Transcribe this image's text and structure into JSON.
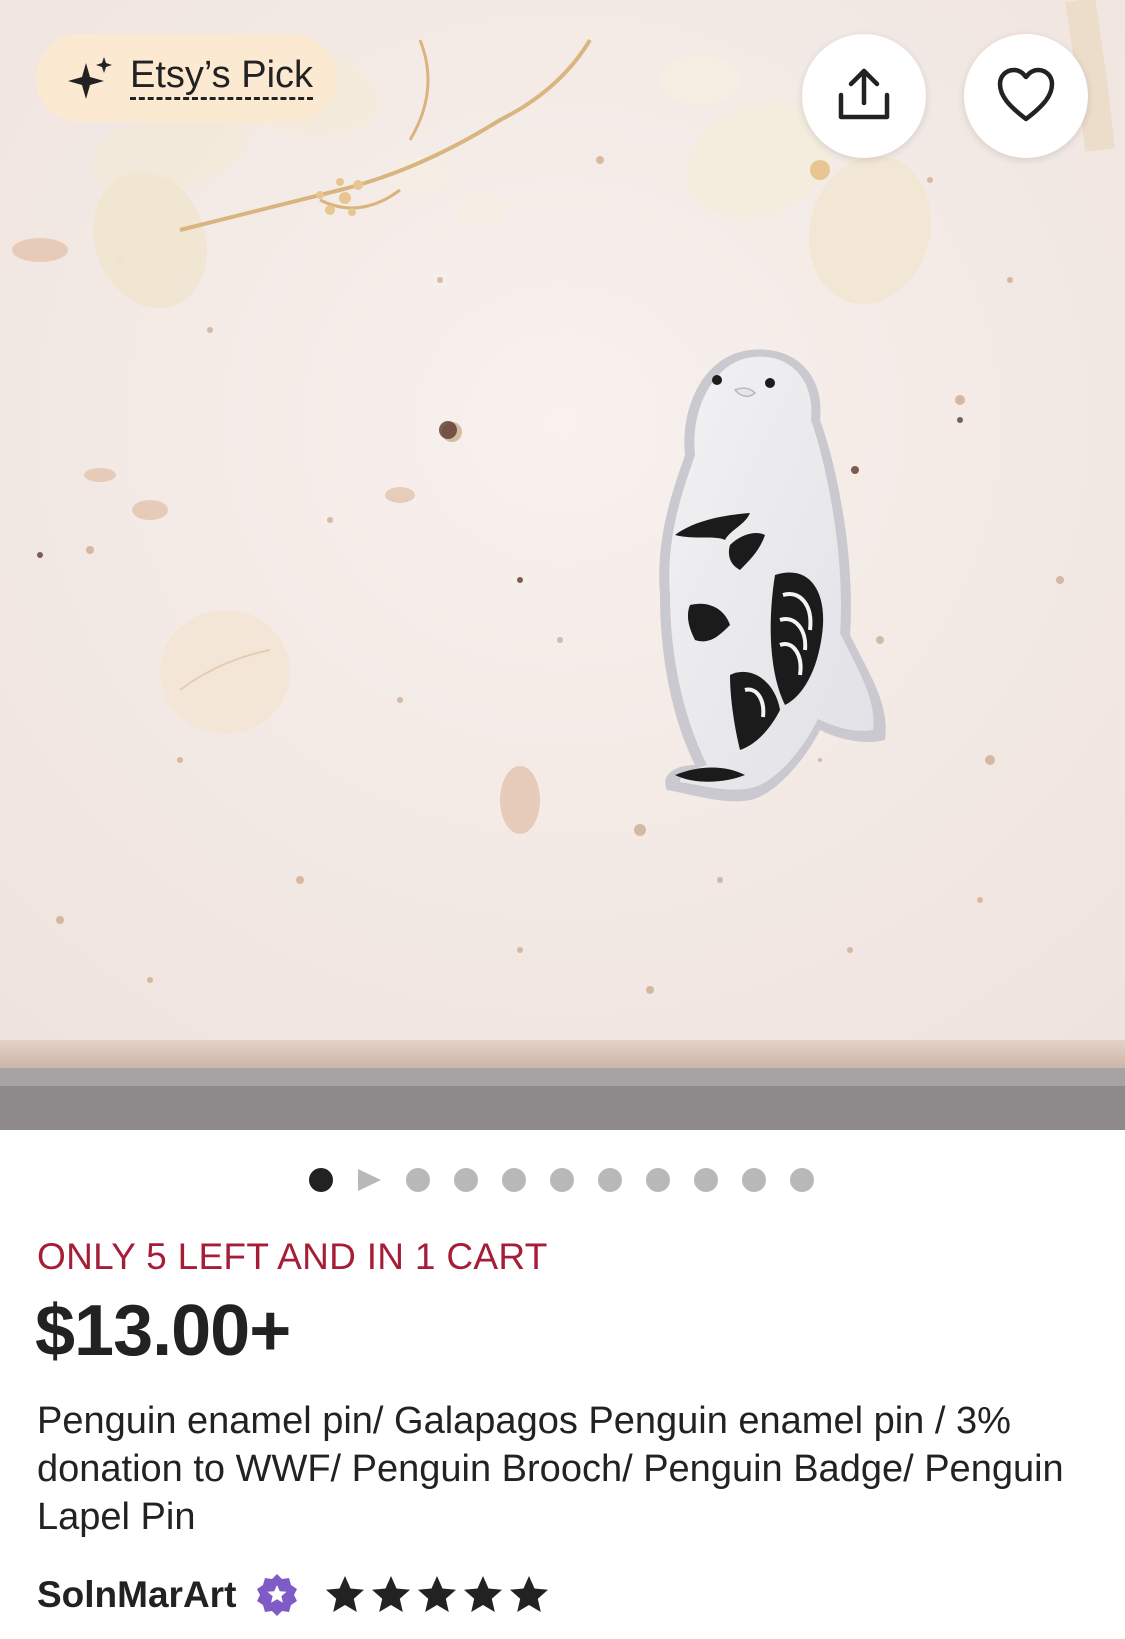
{
  "hero": {
    "badge_label": "Etsy’s Pick",
    "badge_icon": "sparkle-icon",
    "share_icon": "share-icon",
    "favorite_icon": "heart-outline-icon",
    "image_description_icon": "product-photo"
  },
  "carousel": {
    "total_items": 11,
    "active_index": 0,
    "video_index": 1
  },
  "listing": {
    "stock_notice": "ONLY 5 LEFT AND IN 1 CART",
    "price": "$13.00+",
    "title": "Penguin enamel pin/ Galapagos Penguin enamel pin / 3% donation to WWF/ Penguin Brooch/ Penguin Badge/ Penguin Lapel Pin",
    "shop_name": "SolnMarArt",
    "rating": 5,
    "max_rating": 5
  },
  "colors": {
    "stock_notice": "#a51d37",
    "badge_bg": "#fbe9d2",
    "star_seller": "#7f5bc7",
    "text": "#222222",
    "dot_inactive": "#b8b8b8"
  }
}
